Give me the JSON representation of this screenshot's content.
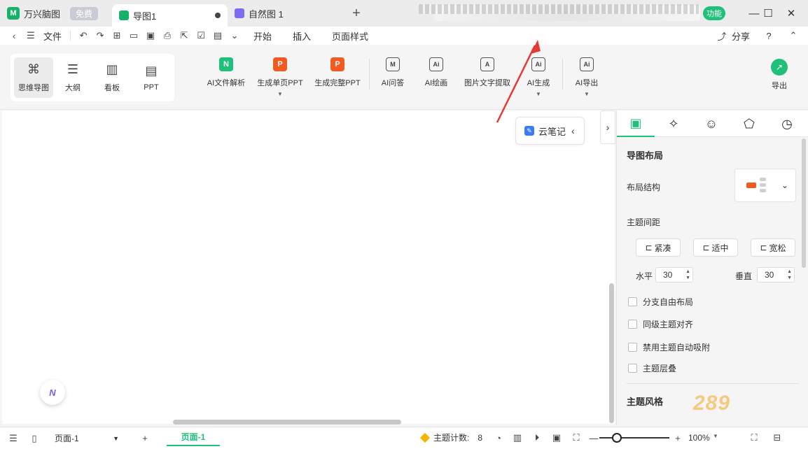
{
  "titlebar": {
    "app_name": "万兴脑图",
    "free_badge": "免费",
    "tabs": [
      {
        "label": "导图1"
      },
      {
        "label": "自然图 1"
      }
    ],
    "ai_pill": "功能",
    "add_tab": "+",
    "minimize": "—",
    "maximize": "☐",
    "close": "✕"
  },
  "menubar": {
    "file": "文件",
    "start": "开始",
    "insert": "插入",
    "page_style": "页面样式",
    "share": "分享",
    "help": "?"
  },
  "views": [
    {
      "label": "思维导图",
      "icon": "mindmap-icon"
    },
    {
      "label": "大纲",
      "icon": "outline-icon"
    },
    {
      "label": "看板",
      "icon": "kanban-icon"
    },
    {
      "label": "PPT",
      "icon": "ppt-icon"
    }
  ],
  "ribbon": {
    "ai_parse": "AI文件解析",
    "gen_single_ppt": "生成单页PPT",
    "gen_full_ppt": "生成完整PPT",
    "ai_qa": "AI问答",
    "ai_draw": "AI绘画",
    "ocr": "图片文字提取",
    "ai_gen": "AI生成",
    "ai_export": "AI导出",
    "export": "导出"
  },
  "canvas": {
    "cloud_note": "云笔记",
    "fab_label": "N"
  },
  "panel": {
    "section_layout": "导图布局",
    "layout_structure": "布局结构",
    "topic_spacing": "主题间距",
    "spacing_options": [
      "紧凑",
      "适中",
      "宽松"
    ],
    "horizontal": "水平",
    "horizontal_value": "30",
    "vertical": "垂直",
    "vertical_value": "30",
    "checks": [
      "分支自由布局",
      "同级主题对齐",
      "禁用主题自动吸附",
      "主题层叠"
    ],
    "section_style": "主题风格"
  },
  "statusbar": {
    "page_select": "页面-1",
    "page_tab": "页面-1",
    "topic_count_label": "主题计数:",
    "topic_count_value": "8",
    "zoom": "100%",
    "add_page": "+"
  },
  "watermark": "289",
  "colors": {
    "accent": "#1ec07a",
    "orange": "#f25a22",
    "arrow": "#e53935"
  }
}
